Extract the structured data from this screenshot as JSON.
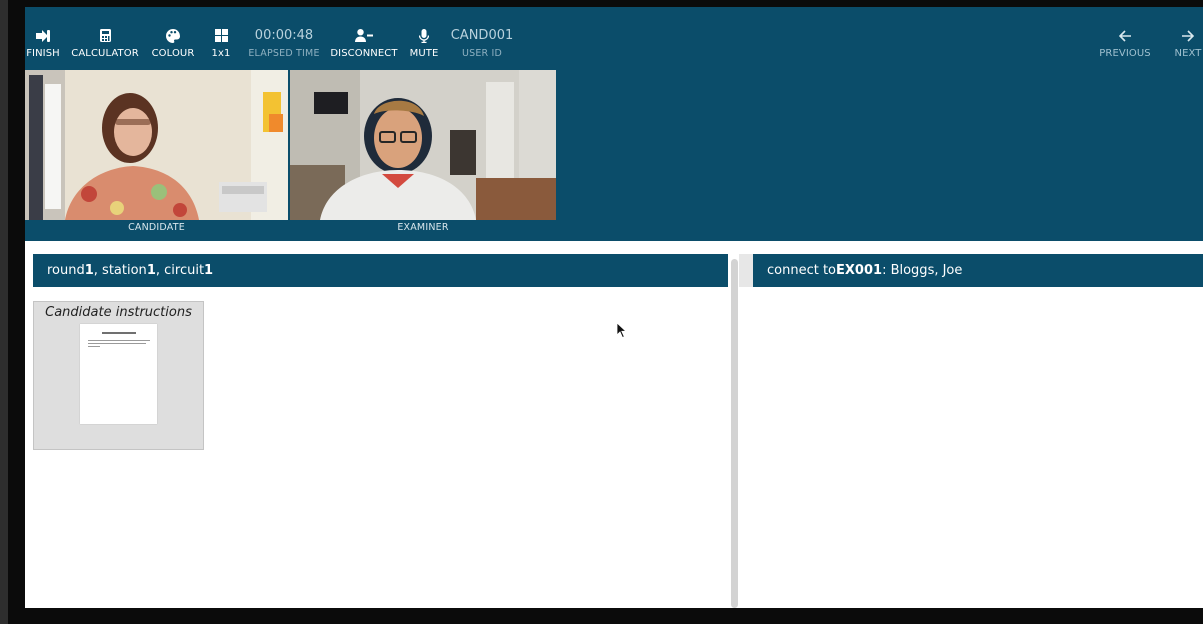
{
  "toolbar": {
    "finish": "FINISH",
    "calculator": "CALCULATOR",
    "colour": "COLOUR",
    "layout": "1x1",
    "elapsed_value": "00:00:48",
    "elapsed_label": "ELAPSED TIME",
    "disconnect": "DISCONNECT",
    "mute": "MUTE",
    "user_id_value": "CAND001",
    "user_id_label": "USER ID",
    "previous": "PREVIOUS",
    "next": "NEXT"
  },
  "videos": {
    "candidate_label": "CANDIDATE",
    "examiner_label": "EXAMINER"
  },
  "left_panel": {
    "header_round_text": "round ",
    "round": "1",
    "header_station_text": ", station ",
    "station": "1",
    "header_circuit_text": ", circuit ",
    "circuit": "1",
    "document_title": "Candidate instructions"
  },
  "right_panel": {
    "connect_text": "connect to ",
    "examiner_id": "EX001",
    "examiner_name": ": Bloggs, Joe"
  },
  "colors": {
    "primary": "#0b4d6a",
    "background": "#ffffff",
    "card": "#dedede"
  }
}
